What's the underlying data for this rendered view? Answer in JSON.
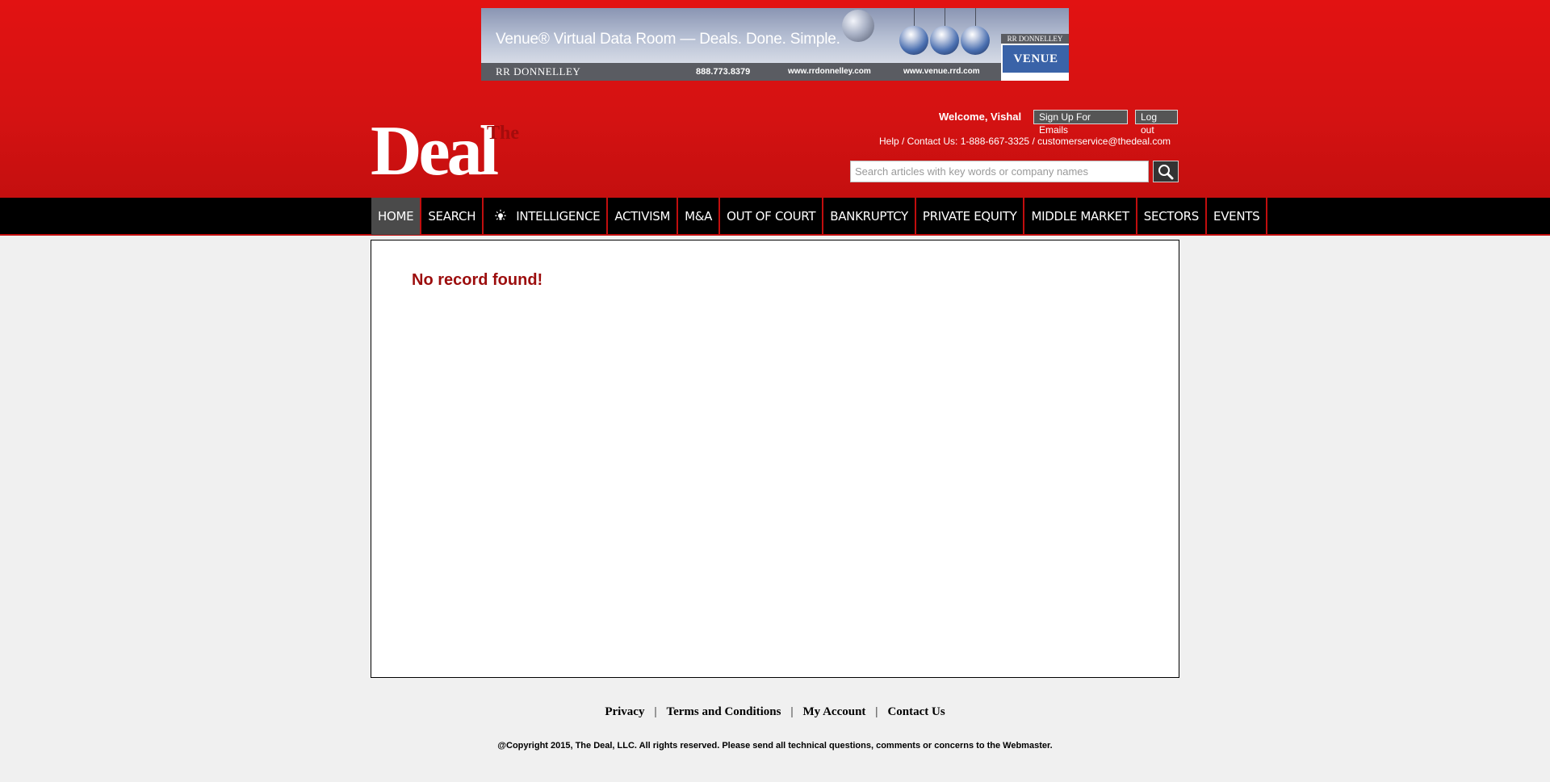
{
  "banner": {
    "headline": "Venue® Virtual Data Room — Deals. Done. Simple.",
    "brand": "RR DONNELLEY",
    "phone": "888.773.8379",
    "url1": "www.rrdonnelley.com",
    "url2": "www.venue.rrd.com",
    "venue_top": "RR DONNELLEY",
    "venue_logo": "VENUE"
  },
  "logo": {
    "the": "The",
    "deal": "Deal"
  },
  "header": {
    "welcome": "Welcome, Vishal",
    "signup_label": "Sign Up For Emails",
    "logout_label": "Log out",
    "help": "Help / Contact Us: 1-888-667-3325 / customerservice@thedeal.com"
  },
  "search": {
    "placeholder": "Search articles with key words or company names"
  },
  "nav": {
    "items": [
      {
        "label": "HOME",
        "active": true
      },
      {
        "label": "SEARCH"
      },
      {
        "label": "INTELLIGENCE",
        "icon": "lightbulb-icon"
      },
      {
        "label": "ACTIVISM"
      },
      {
        "label": "M&A"
      },
      {
        "label": "OUT OF COURT"
      },
      {
        "label": "BANKRUPTCY"
      },
      {
        "label": "PRIVATE EQUITY"
      },
      {
        "label": "MIDDLE MARKET"
      },
      {
        "label": "SECTORS"
      },
      {
        "label": "EVENTS"
      }
    ]
  },
  "main": {
    "message": "No record found!"
  },
  "footer": {
    "links": [
      "Privacy",
      "Terms and Conditions",
      "My Account",
      "Contact Us"
    ],
    "separator": "|",
    "copyright": "@Copyright 2015, The Deal, LLC. All rights reserved. Please send all technical questions, comments or concerns to the Webmaster."
  },
  "colors": {
    "header_red": "#d41212",
    "nav_black": "#000000",
    "accent_red": "#9c0d0d"
  }
}
